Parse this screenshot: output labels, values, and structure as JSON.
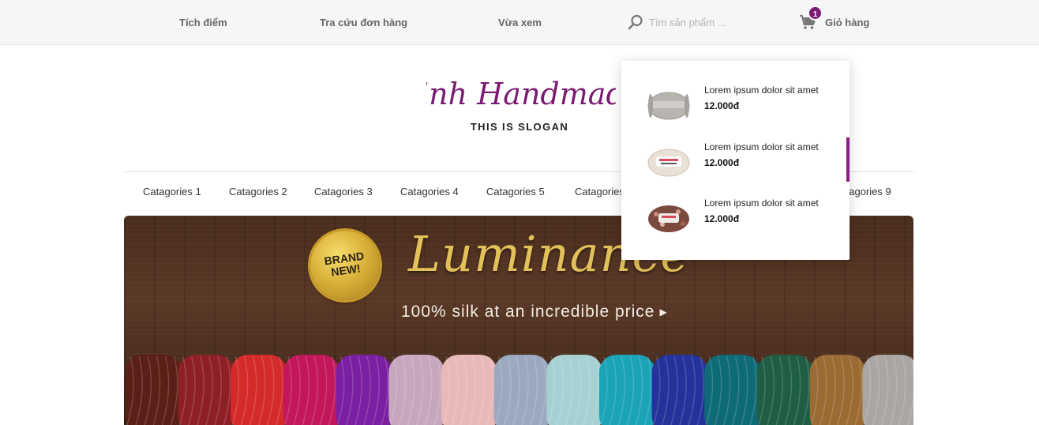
{
  "topbar": {
    "links": [
      "Tích điểm",
      "Tra cứu đơn hàng",
      "Vừa xem"
    ],
    "search": {
      "placeholder": "Tìm sản phẩm ...",
      "value": "",
      "icon": "search-icon"
    },
    "cart": {
      "label": "Giỏ hàng",
      "count": "1",
      "icon": "cart-icon",
      "badge_color": "#7a1a73"
    }
  },
  "brand": {
    "logo_text": "Linh Handmade",
    "slogan": "THIS IS SLOGAN",
    "color": "#7a1a73"
  },
  "categories": [
    "Catagories 1",
    "Catagories 2",
    "Catagories 3",
    "Catagories 4",
    "Catagories 5",
    "Catagories",
    "Catagories 9"
  ],
  "banner": {
    "badge": "BRAND NEW!",
    "headline": "Luminance",
    "subline": "100% silk at an incredible price"
  },
  "cart_dropdown": {
    "items": [
      {
        "name": "Lorem ipsum dolor sit amet",
        "price": "12.000đ",
        "thumb": "yarn-gray"
      },
      {
        "name": "Lorem ipsum dolor sit amet",
        "price": "12.000đ",
        "thumb": "yarn-cream"
      },
      {
        "name": "Lorem ipsum dolor sit amet",
        "price": "12.000đ",
        "thumb": "yarn-brown"
      }
    ],
    "scroll_color": "#8a1d84"
  }
}
